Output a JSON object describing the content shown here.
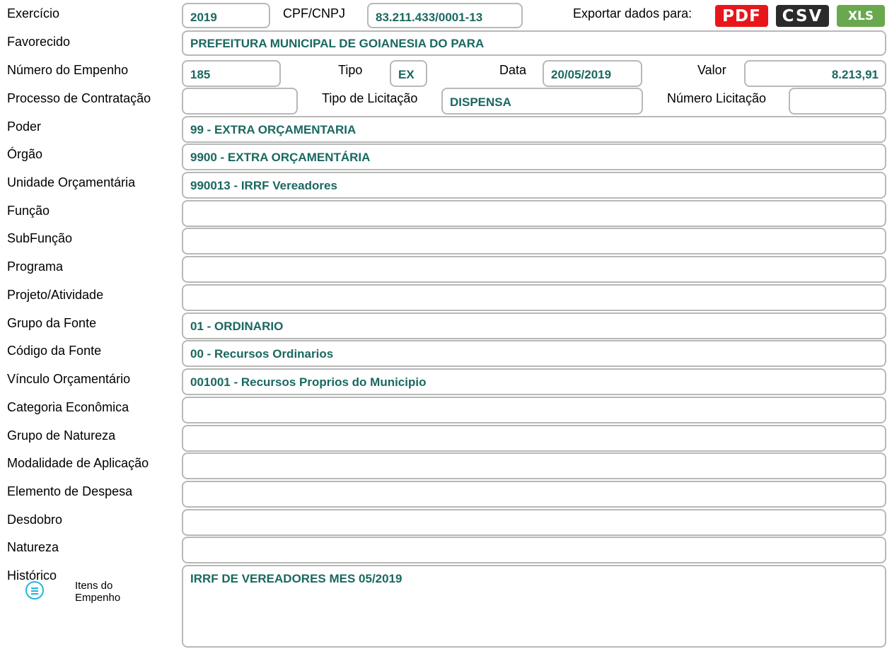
{
  "export": {
    "label": "Exportar dados para:",
    "pdf": "PDF",
    "csv": "CSV",
    "xls": "XLS"
  },
  "labels": {
    "exercicio": "Exercício",
    "cpf": "CPF/CNPJ",
    "favorecido": "Favorecido",
    "numero_empenho": "Número do Empenho",
    "tipo": "Tipo",
    "data": "Data",
    "valor": "Valor",
    "processo": "Processo de Contratação",
    "tipo_licitacao": "Tipo de Licitação",
    "numero_licitacao": "Número Licitação",
    "poder": "Poder",
    "orgao": "Órgão",
    "unidade": "Unidade Orçamentária",
    "funcao": "Função",
    "subfuncao": "SubFunção",
    "programa": "Programa",
    "projeto": "Projeto/Atividade",
    "grupo_fonte": "Grupo da Fonte",
    "codigo_fonte": "Código da Fonte",
    "vinculo": "Vínculo Orçamentário",
    "categoria": "Categoria Econômica",
    "grupo_natureza": "Grupo de Natureza",
    "modalidade": "Modalidade de Aplicação",
    "elemento": "Elemento de Despesa",
    "desdobro": "Desdobro",
    "natureza": "Natureza",
    "historico": "Histórico"
  },
  "values": {
    "exercicio": "2019",
    "cpf": "83.211.433/0001-13",
    "favorecido": "PREFEITURA MUNICIPAL DE GOIANESIA DO PARA",
    "numero_empenho": "185",
    "tipo": "EX",
    "data": "20/05/2019",
    "valor": "8.213,91",
    "processo": "",
    "tipo_licitacao": "DISPENSA",
    "numero_licitacao": "",
    "poder": "99 - EXTRA ORÇAMENTARIA",
    "orgao": "9900 - EXTRA ORÇAMENTÁRIA",
    "unidade": "990013 - IRRF Vereadores",
    "funcao": "",
    "subfuncao": "",
    "programa": "",
    "projeto": "",
    "grupo_fonte": "01 - ORDINARIO",
    "codigo_fonte": "00 - Recursos Ordinarios",
    "vinculo": "001001 - Recursos Proprios do Municipio",
    "categoria": "",
    "grupo_natureza": "",
    "modalidade": "",
    "elemento": "",
    "desdobro": "",
    "natureza": "",
    "historico": "IRRF DE VEREADORES MES 05/2019"
  },
  "itens": {
    "line1": "Itens do",
    "line2": "Empenho",
    "icon": "list-icon"
  },
  "colors": {
    "value_text": "#1a6860",
    "pdf": "#e8161b",
    "csv": "#2b2b2b",
    "xls": "#6aa84f",
    "itens_icon": "#20b8d8"
  }
}
